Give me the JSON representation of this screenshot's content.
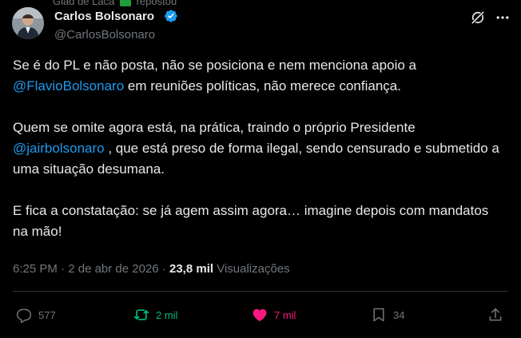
{
  "repost_context": {
    "text_pre": "Glad de Laca",
    "text_post": "repostou"
  },
  "author": {
    "display_name": "Carlos Bolsonaro",
    "handle": "@CarlosBolsonaro"
  },
  "tweet": {
    "p1_pre": "Se é do PL e não posta, não se posiciona e nem menciona apoio a ",
    "p1_mention": "@FlavioBolsonaro",
    "p1_post": " em reuniões políticas, não merece confiança.",
    "p2_pre": "Quem se omite agora está, na prática, traindo o próprio Presidente ",
    "p2_mention": "@jairbolsonaro",
    "p2_post": " , que está preso de forma ilegal, sendo censurado e submetido a uma situação desumana.",
    "p3": "E fica a constatação: se já agem assim agora… imagine depois com mandatos na mão!"
  },
  "meta": {
    "time": "6:25 PM",
    "separator": " · ",
    "date": "2 de abr de 2026",
    "views_count": "23,8 mil",
    "views_label": "Visualizações"
  },
  "actions": {
    "replies": "577",
    "reposts": "2 mil",
    "likes": "7 mil",
    "bookmarks": "34"
  },
  "colors": {
    "background": "#000000",
    "text": "#e7e9ea",
    "secondary": "#71767b",
    "link": "#1d9bf0",
    "repost_active": "#00ba7c",
    "like_active": "#f91880",
    "divider": "#2f3336"
  }
}
